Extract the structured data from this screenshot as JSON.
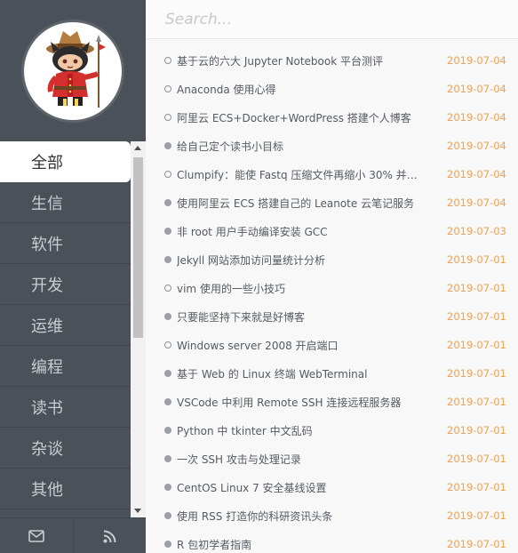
{
  "search": {
    "placeholder": "Search..."
  },
  "sidebar": {
    "items": [
      {
        "label": "全部",
        "active": true
      },
      {
        "label": "生信"
      },
      {
        "label": "软件"
      },
      {
        "label": "开发"
      },
      {
        "label": "运维"
      },
      {
        "label": "编程"
      },
      {
        "label": "读书"
      },
      {
        "label": "杂谈"
      },
      {
        "label": "其他"
      }
    ],
    "footer": [
      "mail-icon",
      "rss-icon"
    ]
  },
  "posts": [
    {
      "title": "基于云的六大 Jupyter Notebook 平台测评",
      "date": "2019-07-04",
      "marker": "hollow"
    },
    {
      "title": "Anaconda 使用心得",
      "date": "2019-07-04",
      "marker": "hollow"
    },
    {
      "title": "阿里云 ECS+Docker+WordPress 搭建个人博客",
      "date": "2019-07-04",
      "marker": "hollow"
    },
    {
      "title": "给自己定个读书小目标",
      "date": "2019-07-04",
      "marker": "filled"
    },
    {
      "title": "Clumpify：能使 Fastq 压缩文件再缩小 30% 并加速...",
      "date": "2019-07-04",
      "marker": "hollow"
    },
    {
      "title": "使用阿里云 ECS 搭建自己的 Leanote 云笔记服务",
      "date": "2019-07-04",
      "marker": "filled"
    },
    {
      "title": "非 root 用户手动编译安装 GCC",
      "date": "2019-07-03",
      "marker": "filled"
    },
    {
      "title": "Jekyll 网站添加访问量统计分析",
      "date": "2019-07-01",
      "marker": "filled"
    },
    {
      "title": "vim 使用的一些小技巧",
      "date": "2019-07-01",
      "marker": "hollow"
    },
    {
      "title": "只要能坚持下来就是好博客",
      "date": "2019-07-01",
      "marker": "filled"
    },
    {
      "title": "Windows server 2008 开启端口",
      "date": "2019-07-01",
      "marker": "hollow"
    },
    {
      "title": "基于 Web 的 Linux 终端 WebTerminal",
      "date": "2019-07-01",
      "marker": "filled"
    },
    {
      "title": "VSCode 中利用 Remote SSH 连接远程服务器",
      "date": "2019-07-01",
      "marker": "filled"
    },
    {
      "title": "Python 中 tkinter 中文乱码",
      "date": "2019-07-01",
      "marker": "filled"
    },
    {
      "title": "一次 SSH 攻击与处理记录",
      "date": "2019-07-01",
      "marker": "filled"
    },
    {
      "title": "CentOS Linux 7 安全基线设置",
      "date": "2019-07-01",
      "marker": "filled"
    },
    {
      "title": "使用 RSS 打造你的科研资讯头条",
      "date": "2019-07-01",
      "marker": "filled"
    },
    {
      "title": "R 包初学者指南",
      "date": "2019-07-01",
      "marker": "filled"
    }
  ],
  "colors": {
    "sidebar_bg": "#4b5159",
    "date": "#f0a050",
    "active_bg": "#ffffff"
  }
}
